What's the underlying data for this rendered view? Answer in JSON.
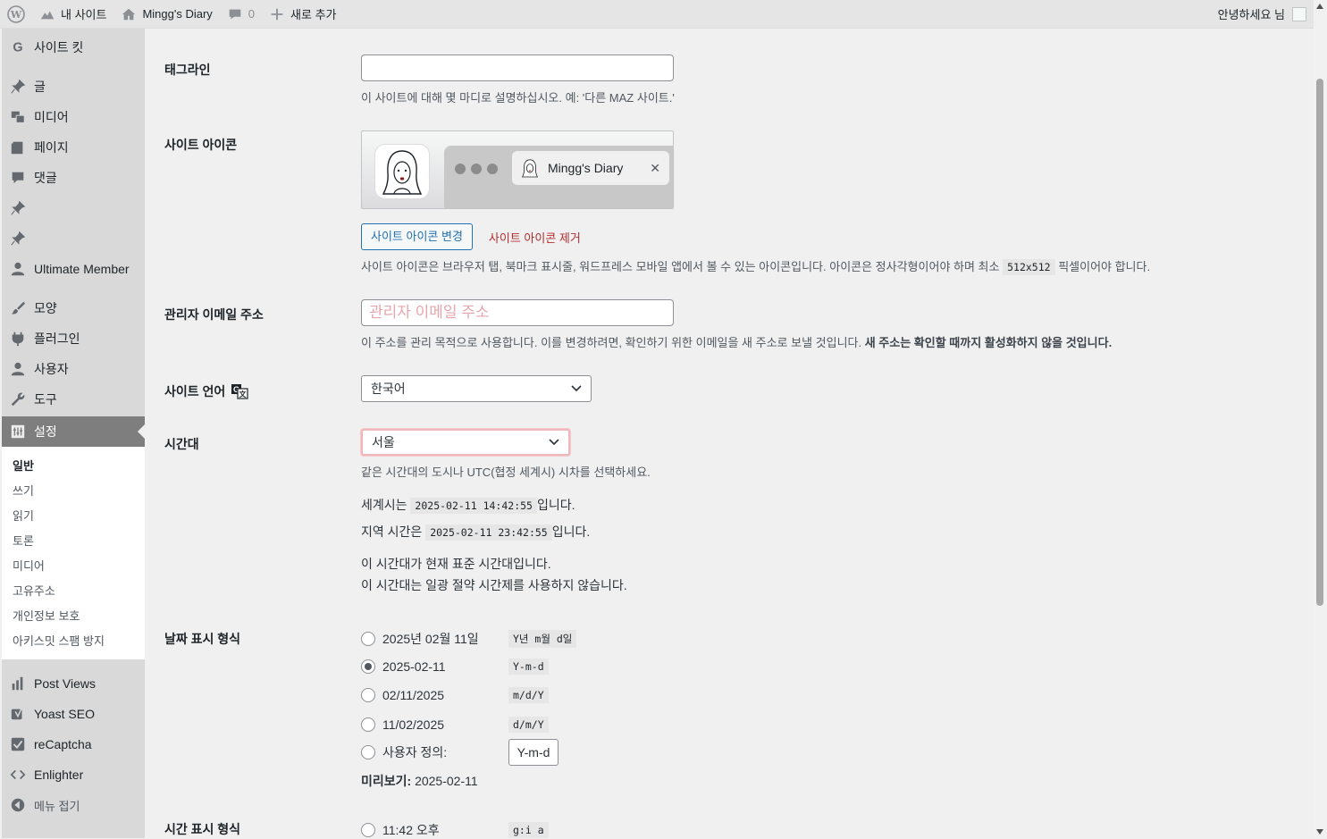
{
  "adminbar": {
    "my_sites": "내 사이트",
    "site_name": "Mingg's Diary",
    "comments_count": "0",
    "new": "새로 추가",
    "greeting": "안녕하세요 님"
  },
  "sidebar": {
    "items": [
      {
        "label": "사이트 킷",
        "icon": "google-g-icon"
      },
      {
        "label": "글",
        "icon": "pin-icon"
      },
      {
        "label": "미디어",
        "icon": "media-icon"
      },
      {
        "label": "페이지",
        "icon": "page-icon"
      },
      {
        "label": "댓글",
        "icon": "comment-icon"
      },
      {
        "label": "",
        "icon": "pin-icon"
      },
      {
        "label": "",
        "icon": "pin-icon"
      },
      {
        "label": "Ultimate Member",
        "icon": "user-icon"
      },
      {
        "label": "모양",
        "icon": "brush-icon"
      },
      {
        "label": "플러그인",
        "icon": "plugin-icon"
      },
      {
        "label": "사용자",
        "icon": "user-icon"
      },
      {
        "label": "도구",
        "icon": "wrench-icon"
      },
      {
        "label": "설정",
        "icon": "settings-icon"
      }
    ],
    "submenu": [
      "일반",
      "쓰기",
      "읽기",
      "토론",
      "미디어",
      "고유주소",
      "개인정보 보호",
      "아키스밋 스팸 방지"
    ],
    "bottom_items": [
      {
        "label": "Post Views",
        "icon": "bar-chart-icon"
      },
      {
        "label": "Yoast SEO",
        "icon": "yoast-icon"
      },
      {
        "label": "reCaptcha",
        "icon": "checkbox-icon"
      },
      {
        "label": "Enlighter",
        "icon": "code-icon"
      },
      {
        "label": "메뉴 접기",
        "icon": "collapse-icon"
      }
    ]
  },
  "form": {
    "tagline": {
      "label": "태그라인",
      "value": "",
      "desc": "이 사이트에 대해 몇 마디로 설명하십시오. 예: '다른 MAZ 사이트.'"
    },
    "site_icon": {
      "label": "사이트 아이콘",
      "tab_title": "Mingg's Diary",
      "change_button": "사이트 아이콘 변경",
      "remove_link": "사이트 아이콘 제거",
      "desc_prefix": "사이트 아이콘은 브라우저 탭, 북마크 표시줄, 워드프레스 모바일 앱에서 볼 수 있는 아이콘입니다. 아이콘은 정사각형이어야 하며 최소",
      "size_code": "512x512",
      "desc_suffix": "픽셀이어야 합니다."
    },
    "admin_email": {
      "label": "관리자 이메일 주소",
      "placeholder": "관리자 이메일 주소",
      "desc": "이 주소를 관리 목적으로 사용합니다. 이를 변경하려면, 확인하기 위한 이메일을 새 주소로 보낼 것입니다.",
      "desc_bold": "새 주소는 확인할 때까지 활성화하지 않을 것입니다."
    },
    "language": {
      "label": "사이트 언어",
      "value": "한국어"
    },
    "timezone": {
      "label": "시간대",
      "value": "서울",
      "desc": "같은 시간대의 도시나 UTC(협정 세계시) 시차를 선택하세요.",
      "utc_prefix": "세계시는",
      "utc_time": "2025-02-11 14:42:55",
      "utc_suffix": "입니다.",
      "local_prefix": "지역 시간은",
      "local_time": "2025-02-11 23:42:55",
      "local_suffix": "입니다.",
      "std_note": "이 시간대가 현재 표준 시간대입니다.",
      "dst_note": "이 시간대는 일광 절약 시간제를 사용하지 않습니다."
    },
    "date_format": {
      "label": "날짜 표시 형식",
      "options": [
        {
          "label": "2025년 02월 11일",
          "code": "Y년 m월 d일",
          "checked": false
        },
        {
          "label": "2025-02-11",
          "code": "Y-m-d",
          "checked": true
        },
        {
          "label": "02/11/2025",
          "code": "m/d/Y",
          "checked": false
        },
        {
          "label": "11/02/2025",
          "code": "d/m/Y",
          "checked": false
        }
      ],
      "custom_label": "사용자 정의:",
      "custom_value": "Y-m-d",
      "preview_label": "미리보기:",
      "preview_value": "2025-02-11"
    },
    "time_format": {
      "label": "시간 표시 형식",
      "first_option": "11:42 오후",
      "first_code": "g:i a"
    }
  }
}
